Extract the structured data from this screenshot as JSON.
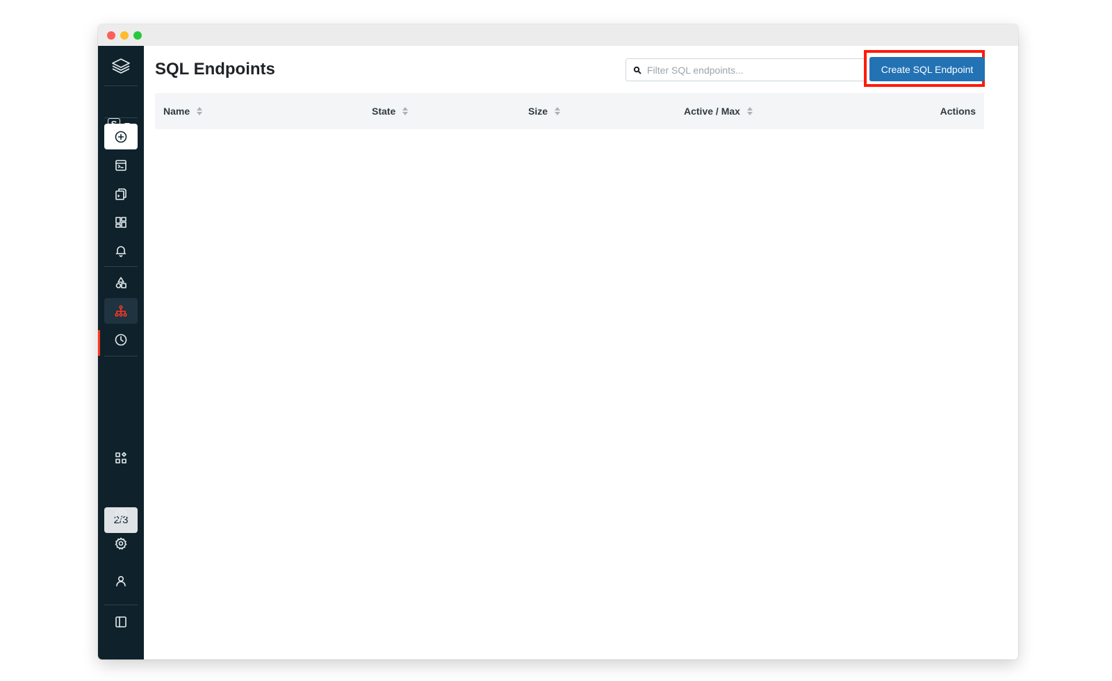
{
  "page": {
    "title": "SQL Endpoints"
  },
  "search": {
    "placeholder": "Filter SQL endpoints..."
  },
  "toolbar": {
    "create_label": "Create SQL Endpoint"
  },
  "table": {
    "columns": [
      {
        "label": "Name",
        "sortable": true
      },
      {
        "label": "State",
        "sortable": true
      },
      {
        "label": "Size",
        "sortable": true
      },
      {
        "label": "Active / Max",
        "sortable": true
      },
      {
        "label": "Actions",
        "sortable": false
      }
    ],
    "rows": []
  },
  "sidebar": {
    "workspace_letter": "S",
    "counter": "2/3",
    "items": [
      {
        "icon": "plus-circle-icon"
      },
      {
        "icon": "sql-editor-icon"
      },
      {
        "icon": "queries-icon"
      },
      {
        "icon": "dashboards-icon"
      },
      {
        "icon": "alerts-icon"
      },
      {
        "icon": "data-icon"
      },
      {
        "icon": "endpoints-icon",
        "active": true
      },
      {
        "icon": "history-icon"
      },
      {
        "icon": "partner-connect-icon"
      },
      {
        "icon": "help-icon"
      },
      {
        "icon": "settings-icon"
      },
      {
        "icon": "user-icon"
      },
      {
        "icon": "collapse-sidebar-icon"
      }
    ]
  },
  "colors": {
    "sidebar_bg": "#0f222b",
    "accent_active": "#ff3621",
    "primary_button": "#2272b4",
    "highlight_border": "#ff1a0a"
  }
}
